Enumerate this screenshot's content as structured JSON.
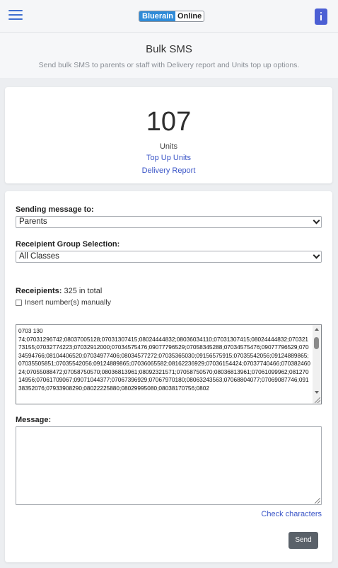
{
  "header": {
    "logo_left": "Bluerain",
    "logo_right": "Online",
    "menu_icon": "hamburger-icon",
    "options_icon": "vertical-dots-icon"
  },
  "page": {
    "title": "Bulk SMS",
    "subtitle": "Send bulk SMS to parents or staff with Delivery report and Units top up options."
  },
  "units": {
    "count": "107",
    "label": "Units",
    "top_up_link": "Top Up Units",
    "delivery_link": "Delivery Report"
  },
  "form": {
    "sending_to_label": "Sending message to:",
    "sending_to_value": "Parents",
    "group_label": "Receipient Group Selection:",
    "group_value": "All Classes",
    "recipients_label": "Receipients:",
    "recipients_count": "325 in total",
    "manual_label": "Insert number(s) manually",
    "manual_checked": false,
    "numbers_line1": "0703 130",
    "numbers_text": "74;07031296742;08037005128;07031307415;08024444832;08036034110;07031307415;08024444832;07032173155;07032774223;07032912000;07034575476;09077796529;07058345288;07034575476;09077796529;07034594766;08104406520;07034977406;08034577272;07035365030;09156575915;07035542056;09124889865;07035505851;07035542056;09124889865;07036065582;08162236929;07036154424;07037740466;07038246024;07055088472;07058750570;08036813961;08092321571;07058750570;08036813961;07061099962;08127014956;07061709067;09071044377;07067396929;07067970180;08063243563;07068804077;07069087746;09138352076;07933908290;08022225880;08029995080;08038170756;0802",
    "message_label": "Message:",
    "message_value": "",
    "check_characters": "Check characters",
    "send_label": "Send"
  },
  "colors": {
    "accent": "#3a55c7",
    "kebab_bg": "#4b5fd4",
    "send_bg": "#5a6169"
  }
}
